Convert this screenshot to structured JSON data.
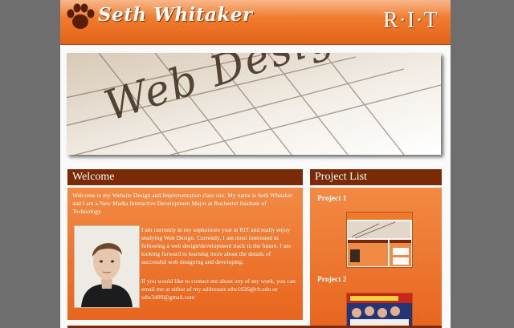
{
  "header": {
    "site_title": "Seth Whitaker",
    "logo_text": "R·I·T",
    "paw_icon": "paw-icon"
  },
  "banner": {
    "word": "Web Design"
  },
  "welcome": {
    "heading": "Welcome",
    "intro": "Welcome to my Website Design and Implementation class site. My name is Seth Whitaker and I am a New Media Interactive Development Major at Rochester Institute of Technology.",
    "para2": "I am currently in my sophomore year at RIT and really enjoy studying Web Design. Currently, I am most interested in following a web design/development track in the future. I am looking forward to learning more about the details of successful web designing and developing.",
    "para3": "If you would like to contact me about any of my work, you can email me at either of my addresses sdw1026@rit.edu or sdw3489@gmail.com"
  },
  "projects": {
    "heading": "Project List",
    "items": [
      {
        "title": "Project 1"
      },
      {
        "title": "Project 2"
      }
    ]
  },
  "colors": {
    "accent": "#f07a2c",
    "dark_head": "#7a2a06",
    "page_bg": "#6e6e6e"
  }
}
